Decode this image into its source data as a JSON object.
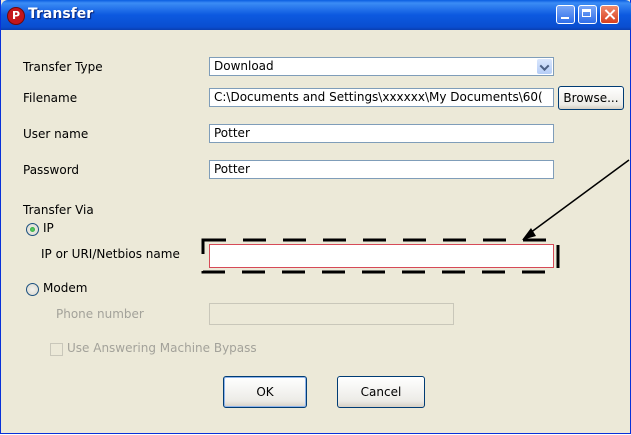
{
  "window": {
    "title": "Transfer",
    "icon_letter": "P"
  },
  "form": {
    "transfer_type_label": "Transfer Type",
    "transfer_type_value": "Download",
    "filename_label": "Filename",
    "filename_value": "C:\\Documents and Settings\\xxxxxx\\My Documents\\60(",
    "browse_label": "Browse...",
    "username_label": "User name",
    "username_value": "Potter",
    "password_label": "Password",
    "password_value": "Potter",
    "transfer_via_label": "Transfer Via",
    "ip_radio_label": "IP",
    "ip_radio_checked": true,
    "ip_field_label": "IP or URI/Netbios name",
    "ip_field_value": "",
    "modem_radio_label": "Modem",
    "modem_radio_checked": false,
    "phone_label": "Phone number",
    "phone_value": "",
    "bypass_label": "Use Answering Machine Bypass",
    "bypass_checked": false
  },
  "buttons": {
    "ok_label": "OK",
    "cancel_label": "Cancel"
  },
  "colors": {
    "titlebar": "#0a5de1",
    "highlight_border": "#d64a57",
    "dialog_bg": "#ece9d8"
  },
  "icons": {
    "title_icon": "app-icon",
    "dropdown": "chevron-down-icon",
    "minimize": "minimize-icon",
    "maximize": "maximize-icon",
    "close": "close-icon",
    "annotation": "arrow-icon"
  }
}
